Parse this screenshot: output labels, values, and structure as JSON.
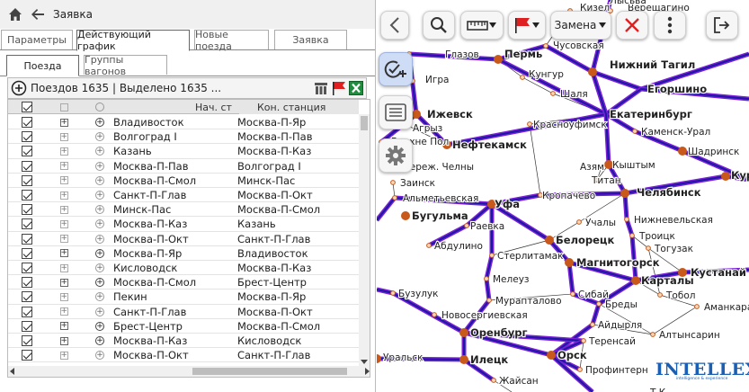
{
  "titlebar": {
    "title": "Заявка"
  },
  "tabs_main": [
    "Параметры",
    "Действующий график",
    "Новые поезда",
    "Заявка"
  ],
  "tabs_sub": [
    "Поезда",
    "Группы вагонов"
  ],
  "toolbar": {
    "count_text": "Поездов 1635 | Выделено 1635 ..."
  },
  "grid": {
    "columns": [
      "",
      "",
      "",
      "Нач. ст",
      "Кон. станция"
    ],
    "rows": [
      {
        "start": "Владивосток",
        "end": "Москва-П-Яр"
      },
      {
        "start": "Волгоград I",
        "end": "Москва-П-Пав"
      },
      {
        "start": "Казань",
        "end": "Москва-П-Каз"
      },
      {
        "start": "Москва-П-Пав",
        "end": "Волгоград I"
      },
      {
        "start": "Москва-П-Смол",
        "end": "Минск-Пас"
      },
      {
        "start": "Санкт-П-Глав",
        "end": "Москва-П-Окт"
      },
      {
        "start": "Минск-Пас",
        "end": "Москва-П-Смол"
      },
      {
        "start": "Москва-П-Каз",
        "end": "Казань"
      },
      {
        "start": "Москва-П-Окт",
        "end": "Санкт-П-Глав"
      },
      {
        "start": "Москва-П-Яр",
        "end": "Владивосток"
      },
      {
        "start": "Кисловодск",
        "end": "Москва-П-Каз"
      },
      {
        "start": "Москва-П-Смол",
        "end": "Брест-Центр"
      },
      {
        "start": "Пекин",
        "end": "Москва-П-Яр"
      },
      {
        "start": "Санкт-П-Глав",
        "end": "Москва-П-Окт"
      },
      {
        "start": "Брест-Центр",
        "end": "Москва-П-Смол"
      },
      {
        "start": "Москва-П-Каз",
        "end": "Кисловодск"
      },
      {
        "start": "Москва-П-Окт",
        "end": "Санкт-П-Глав"
      }
    ]
  },
  "map": {
    "dropdown_label": "Замена",
    "logo": "INTELLEX",
    "logo_sub": "intelligence & experience",
    "cities": [
      {
        "id": "kizel",
        "label": "Кизел"
      },
      {
        "id": "vereshch",
        "label": "Верещагино"
      },
      {
        "id": "lysva",
        "label": "Лысьва"
      },
      {
        "id": "glazov",
        "label": "Глазов"
      },
      {
        "id": "perm",
        "label": "Пермь"
      },
      {
        "id": "chusovskaya",
        "label": "Чусовская"
      },
      {
        "id": "ntagil",
        "label": "Нижний Тагил"
      },
      {
        "id": "kungur",
        "label": "Кунгур"
      },
      {
        "id": "igra",
        "label": "Игра"
      },
      {
        "id": "shalya",
        "label": "Шаля"
      },
      {
        "id": "egorshino",
        "label": "Егоршино"
      },
      {
        "id": "izhevsk",
        "label": "Ижевск"
      },
      {
        "id": "agryz",
        "label": "Агрыз"
      },
      {
        "id": "krasnoufimsk",
        "label": "Красноуфимск"
      },
      {
        "id": "ekaterinburg",
        "label": "Екатеринбург"
      },
      {
        "id": "kamensk",
        "label": "Каменск-Урал"
      },
      {
        "id": "verhpol",
        "label": "Верхне Пол"
      },
      {
        "id": "neftekamsk",
        "label": "Нефтекамск"
      },
      {
        "id": "shadrinsk",
        "label": "Шадринск"
      },
      {
        "id": "azyaz",
        "label": "Азям"
      },
      {
        "id": "kyshtym",
        "label": "Кыштым"
      },
      {
        "id": "chelny",
        "label": "Набереж. Челны"
      },
      {
        "id": "titan",
        "label": "Титан"
      },
      {
        "id": "zainsk",
        "label": "Заинск"
      },
      {
        "id": "kurgan",
        "label": "Курган"
      },
      {
        "id": "almet",
        "label": "Альметьевская"
      },
      {
        "id": "kropachevo",
        "label": "Кропачево"
      },
      {
        "id": "chelyabinsk",
        "label": "Челябинск"
      },
      {
        "id": "ufa",
        "label": "Уфа"
      },
      {
        "id": "bugulma",
        "label": "Бугульма"
      },
      {
        "id": "raevka",
        "label": "Раевка"
      },
      {
        "id": "uchaly",
        "label": "Учалы"
      },
      {
        "id": "nizhneuvel",
        "label": "Нижневельская"
      },
      {
        "id": "abdulino",
        "label": "Абдулино"
      },
      {
        "id": "beloretsk",
        "label": "Белорецк"
      },
      {
        "id": "troitsk",
        "label": "Троицк"
      },
      {
        "id": "togyzak",
        "label": "Тогузак"
      },
      {
        "id": "sterlitamak",
        "label": "Стерлитамак"
      },
      {
        "id": "magnitogorsk",
        "label": "Магнитогорск"
      },
      {
        "id": "kustanai",
        "label": "Кустанай"
      },
      {
        "id": "meleuz",
        "label": "Мелеуз"
      },
      {
        "id": "kartaly",
        "label": "Карталы"
      },
      {
        "id": "buzuluk",
        "label": "Бузулук"
      },
      {
        "id": "sibai",
        "label": "Сибай"
      },
      {
        "id": "tobol",
        "label": "Тобол"
      },
      {
        "id": "muraptalovo",
        "label": "Мурапталово"
      },
      {
        "id": "bredy",
        "label": "Бреды"
      },
      {
        "id": "amankaragai",
        "label": "Аманкарагай"
      },
      {
        "id": "novosergievskaya",
        "label": "Новосергиевская"
      },
      {
        "id": "aidyrlya",
        "label": "Айдырля"
      },
      {
        "id": "orenburg",
        "label": "Оренбург"
      },
      {
        "id": "altynsarin",
        "label": "Алтынсарин"
      },
      {
        "id": "terensai",
        "label": "Теренсай"
      },
      {
        "id": "uralsk",
        "label": "Уральск"
      },
      {
        "id": "iletsk",
        "label": "Илецк"
      },
      {
        "id": "orsk",
        "label": "Орск"
      },
      {
        "id": "profintern",
        "label": "Профинтерн"
      },
      {
        "id": "zhaisan",
        "label": "Жайсан"
      },
      {
        "id": "tk",
        "label": "Т.К"
      }
    ]
  },
  "colors": {
    "route_outer": "#7b1fd8",
    "route_inner": "#1a1aa0",
    "node": "#c8591a",
    "accent_red": "#e02020",
    "excel_green": "#1e8e3e"
  }
}
